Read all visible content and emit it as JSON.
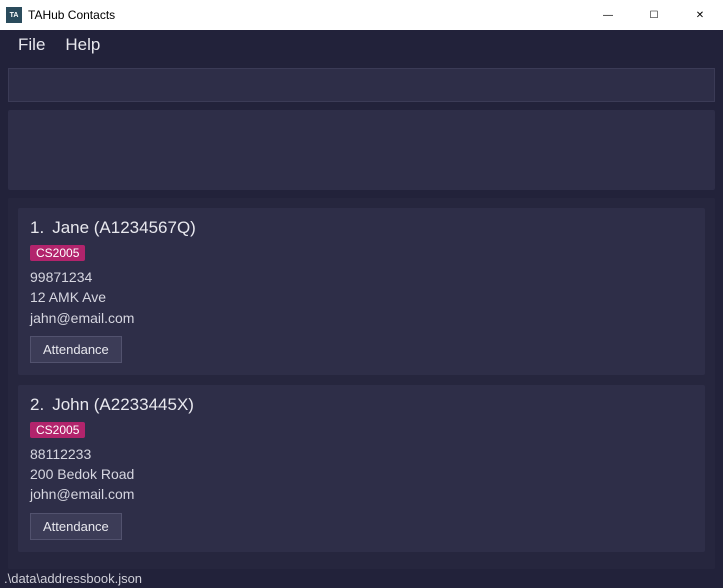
{
  "window": {
    "title": "TAHub Contacts",
    "app_icon_text": "TA"
  },
  "window_controls": {
    "minimize": "—",
    "maximize": "☐",
    "close": "✕"
  },
  "menubar": {
    "file": "File",
    "help": "Help"
  },
  "command_input": {
    "value": "",
    "placeholder": ""
  },
  "result_panel": {
    "text": ""
  },
  "contacts": [
    {
      "index": "1.",
      "name": "Jane (A1234567Q)",
      "tag": "CS2005",
      "phone": "99871234",
      "address": "12 AMK Ave",
      "email": "jahn@email.com",
      "attendance_label": "Attendance"
    },
    {
      "index": "2.",
      "name": "John (A2233445X)",
      "tag": "CS2005",
      "phone": "88112233",
      "address": "200 Bedok Road",
      "email": "john@email.com",
      "attendance_label": "Attendance"
    }
  ],
  "statusbar": {
    "path": ".\\data\\addressbook.json"
  }
}
